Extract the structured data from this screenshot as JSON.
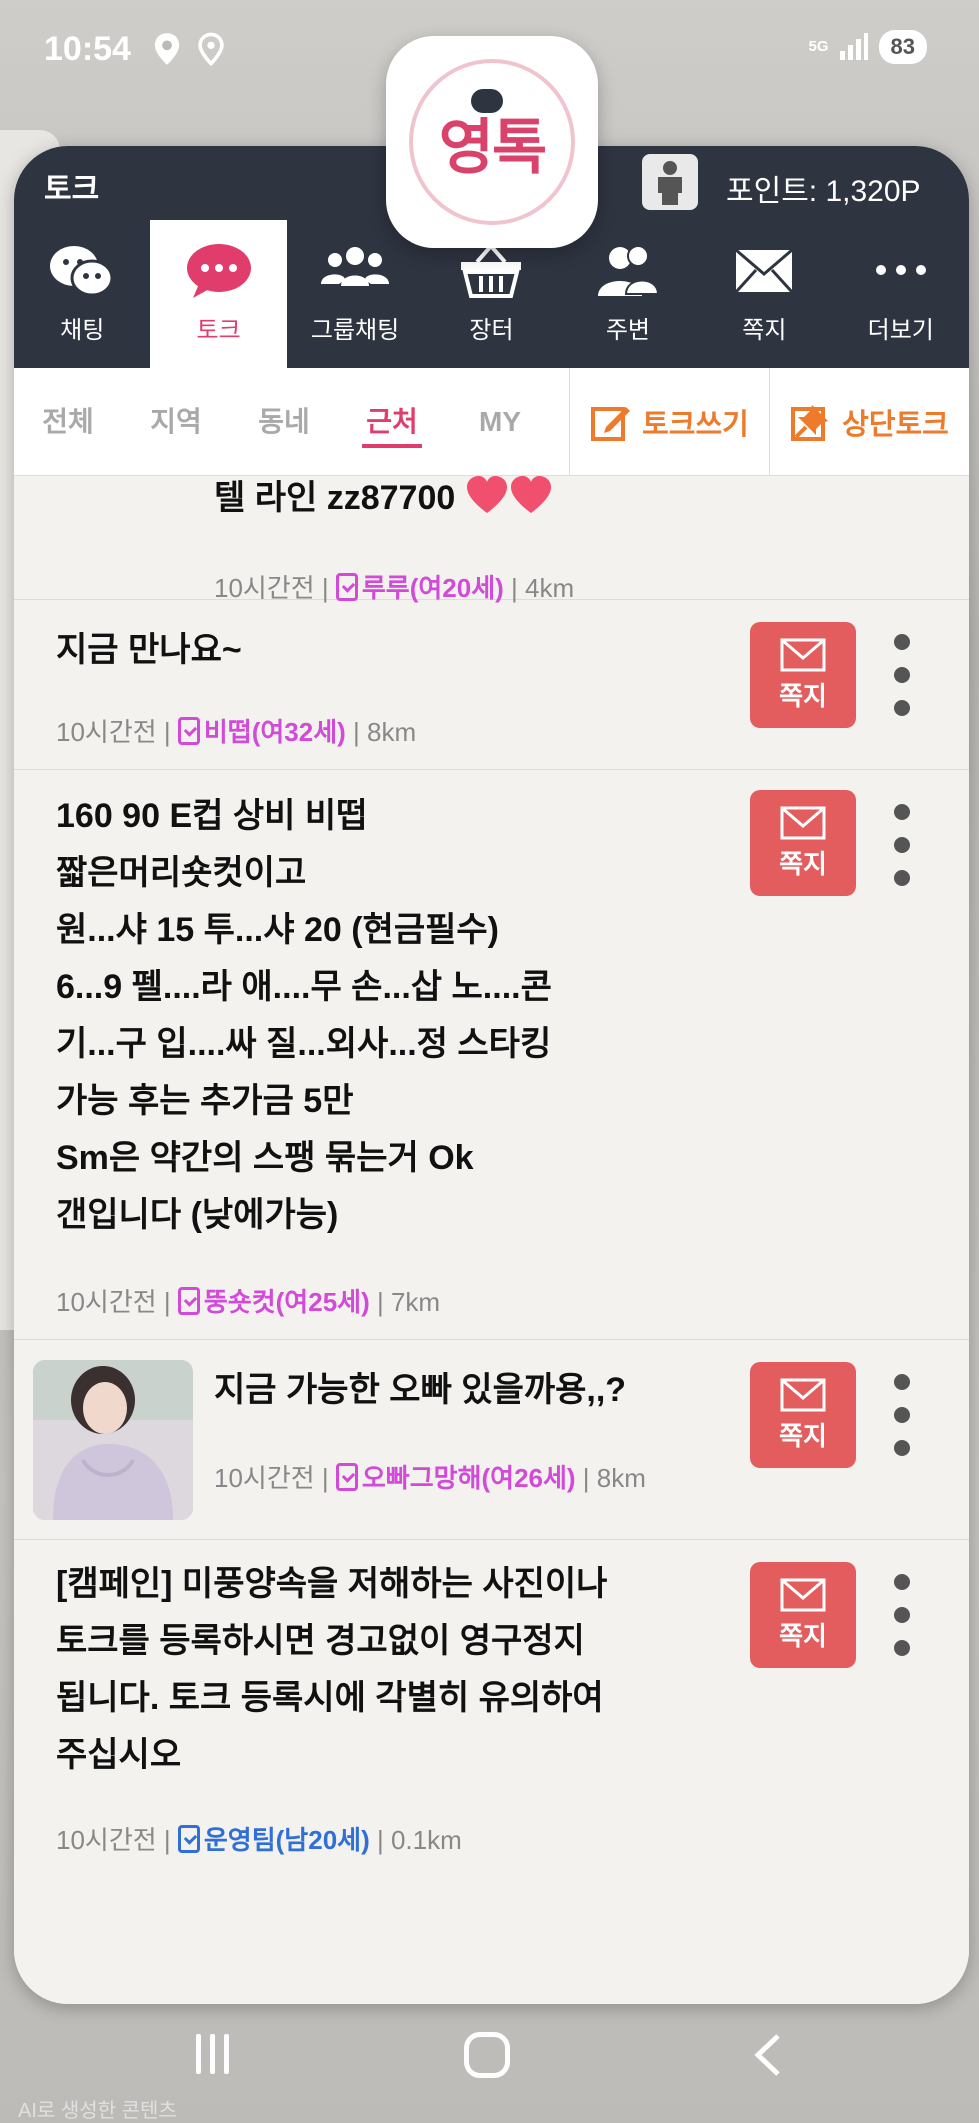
{
  "status": {
    "time": "10:54",
    "network": "5G",
    "battery": "83"
  },
  "logo": {
    "text": "영톡"
  },
  "header": {
    "title": "토크",
    "points": "포인트: 1,320P"
  },
  "tabs": [
    {
      "label": "채팅",
      "icon": "wechat-icon"
    },
    {
      "label": "토크",
      "icon": "chat-bubble-icon"
    },
    {
      "label": "그룹채팅",
      "icon": "group-icon"
    },
    {
      "label": "장터",
      "icon": "basket-icon"
    },
    {
      "label": "주변",
      "icon": "people-icon"
    },
    {
      "label": "쪽지",
      "icon": "envelope-icon"
    },
    {
      "label": "더보기",
      "icon": "more-icon"
    }
  ],
  "filters": [
    "전체",
    "지역",
    "동네",
    "근처",
    "MY"
  ],
  "actions": {
    "write_talk": "토크쓰기",
    "top_talk": "상단토크"
  },
  "posts": [
    {
      "text": "텔 라인 zz87700",
      "time": "10시간전",
      "nickname": "루루(여20세)",
      "distance": "4km"
    },
    {
      "text": "지금 만나요~",
      "time": "10시간전",
      "nickname": "비떱(여32세)",
      "distance": "8km",
      "message_label": "쪽지"
    },
    {
      "lines": [
        "160 90 E컵 상비 비떱",
        "짧은머리숏컷이고",
        "원...샤 15 투...샤 20 (현금필수)",
        "6...9 펠....라 애....무 손...삽 노....콘",
        "기...구 입....싸 질...외사...정 스타킹",
        "가능 후는 추가금 5만",
        "Sm은 약간의 스팽 묶는거 Ok",
        "갠입니다 (낮에가능)"
      ],
      "time": "10시간전",
      "nickname": "뚱숏컷(여25세)",
      "distance": "7km",
      "message_label": "쪽지"
    },
    {
      "text": "지금 가능한 오빠 있을까용,,?",
      "time": "10시간전",
      "nickname": "오빠그망해(여26세)",
      "distance": "8km",
      "message_label": "쪽지"
    },
    {
      "lines": [
        "[캠페인] 미풍양속을 저해하는 사진이나",
        "토크를 등록하시면 경고없이 영구정지",
        "됩니다. 토크 등록시에 각별히 유의하여",
        "주십시오"
      ],
      "time": "10시간전",
      "nickname": "운영팀(남20세)",
      "distance": "0.1km",
      "message_label": "쪽지"
    }
  ],
  "system": {
    "ai_label": "AI로 생성한 콘텐츠"
  }
}
